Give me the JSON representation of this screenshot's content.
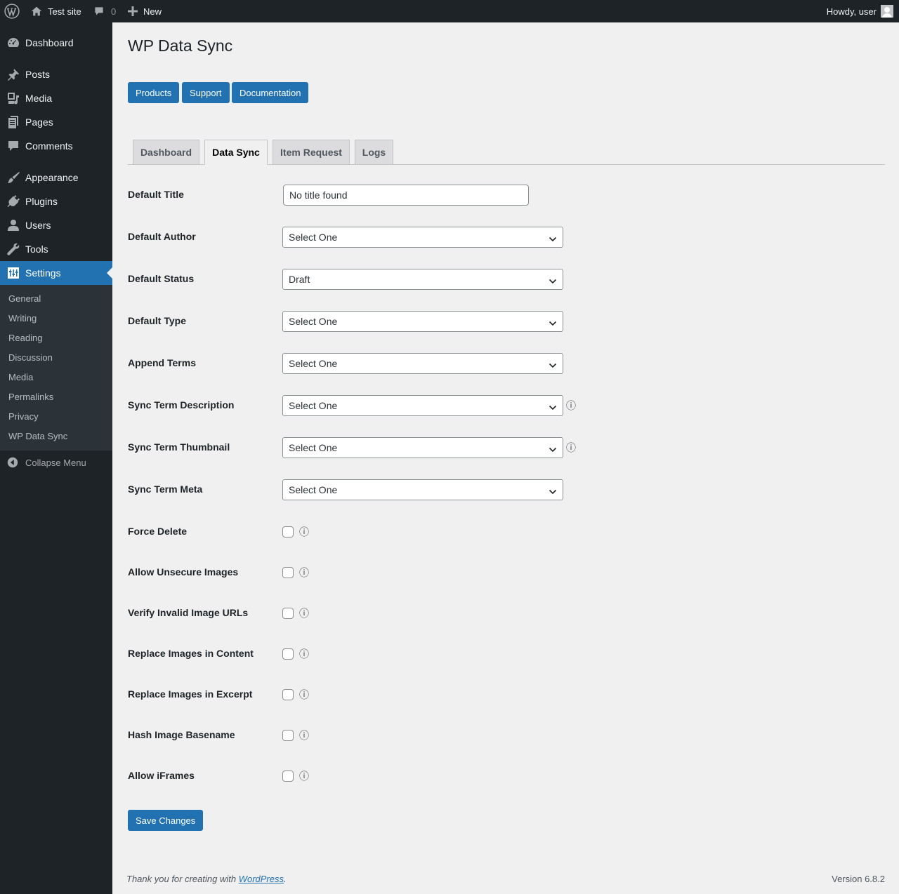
{
  "adminbar": {
    "site_name": "Test site",
    "comments_count": "0",
    "new_label": "New",
    "howdy": "Howdy, user"
  },
  "menu": {
    "items": [
      {
        "label": "Dashboard",
        "icon": "dashboard-icon"
      },
      {
        "label": "Posts",
        "icon": "pin-icon"
      },
      {
        "label": "Media",
        "icon": "media-icon"
      },
      {
        "label": "Pages",
        "icon": "pages-icon"
      },
      {
        "label": "Comments",
        "icon": "comment-icon"
      },
      {
        "label": "Appearance",
        "icon": "brush-icon"
      },
      {
        "label": "Plugins",
        "icon": "plug-icon"
      },
      {
        "label": "Users",
        "icon": "user-icon"
      },
      {
        "label": "Tools",
        "icon": "wrench-icon"
      },
      {
        "label": "Settings",
        "icon": "settings-icon"
      }
    ],
    "submenu": [
      "General",
      "Writing",
      "Reading",
      "Discussion",
      "Media",
      "Permalinks",
      "Privacy",
      "WP Data Sync"
    ],
    "collapse": "Collapse Menu"
  },
  "page": {
    "title": "WP Data Sync",
    "buttons": [
      "Products",
      "Support",
      "Documentation"
    ],
    "tabs": [
      "Dashboard",
      "Data Sync",
      "Item Request",
      "Logs"
    ],
    "active_tab": "Data Sync"
  },
  "form": {
    "default_title": {
      "label": "Default Title",
      "value": "No title found"
    },
    "selects": [
      {
        "label": "Default Author",
        "value": "Select One",
        "info": false
      },
      {
        "label": "Default Status",
        "value": "Draft",
        "info": false
      },
      {
        "label": "Default Type",
        "value": "Select One",
        "info": false
      },
      {
        "label": "Append Terms",
        "value": "Select One",
        "info": false
      },
      {
        "label": "Sync Term Description",
        "value": "Select One",
        "info": true
      },
      {
        "label": "Sync Term Thumbnail",
        "value": "Select One",
        "info": true
      },
      {
        "label": "Sync Term Meta",
        "value": "Select One",
        "info": false
      }
    ],
    "checkboxes": [
      {
        "label": "Force Delete",
        "checked": false
      },
      {
        "label": "Allow Unsecure Images",
        "checked": false
      },
      {
        "label": "Verify Invalid Image URLs",
        "checked": false
      },
      {
        "label": "Replace Images in Content",
        "checked": false
      },
      {
        "label": "Replace Images in Excerpt",
        "checked": false
      },
      {
        "label": "Hash Image Basename",
        "checked": false
      },
      {
        "label": "Allow iFrames",
        "checked": false
      }
    ],
    "info_glyph": "ⓘ",
    "save_label": "Save Changes"
  },
  "footer": {
    "thanks_prefix": "Thank you for creating with ",
    "thanks_link": "WordPress",
    "thanks_suffix": ".",
    "version": "Version 6.8.2"
  },
  "colors": {
    "adminbar_bg": "#1d2327",
    "accent": "#2271b1",
    "page_bg": "#f0f0f1"
  }
}
